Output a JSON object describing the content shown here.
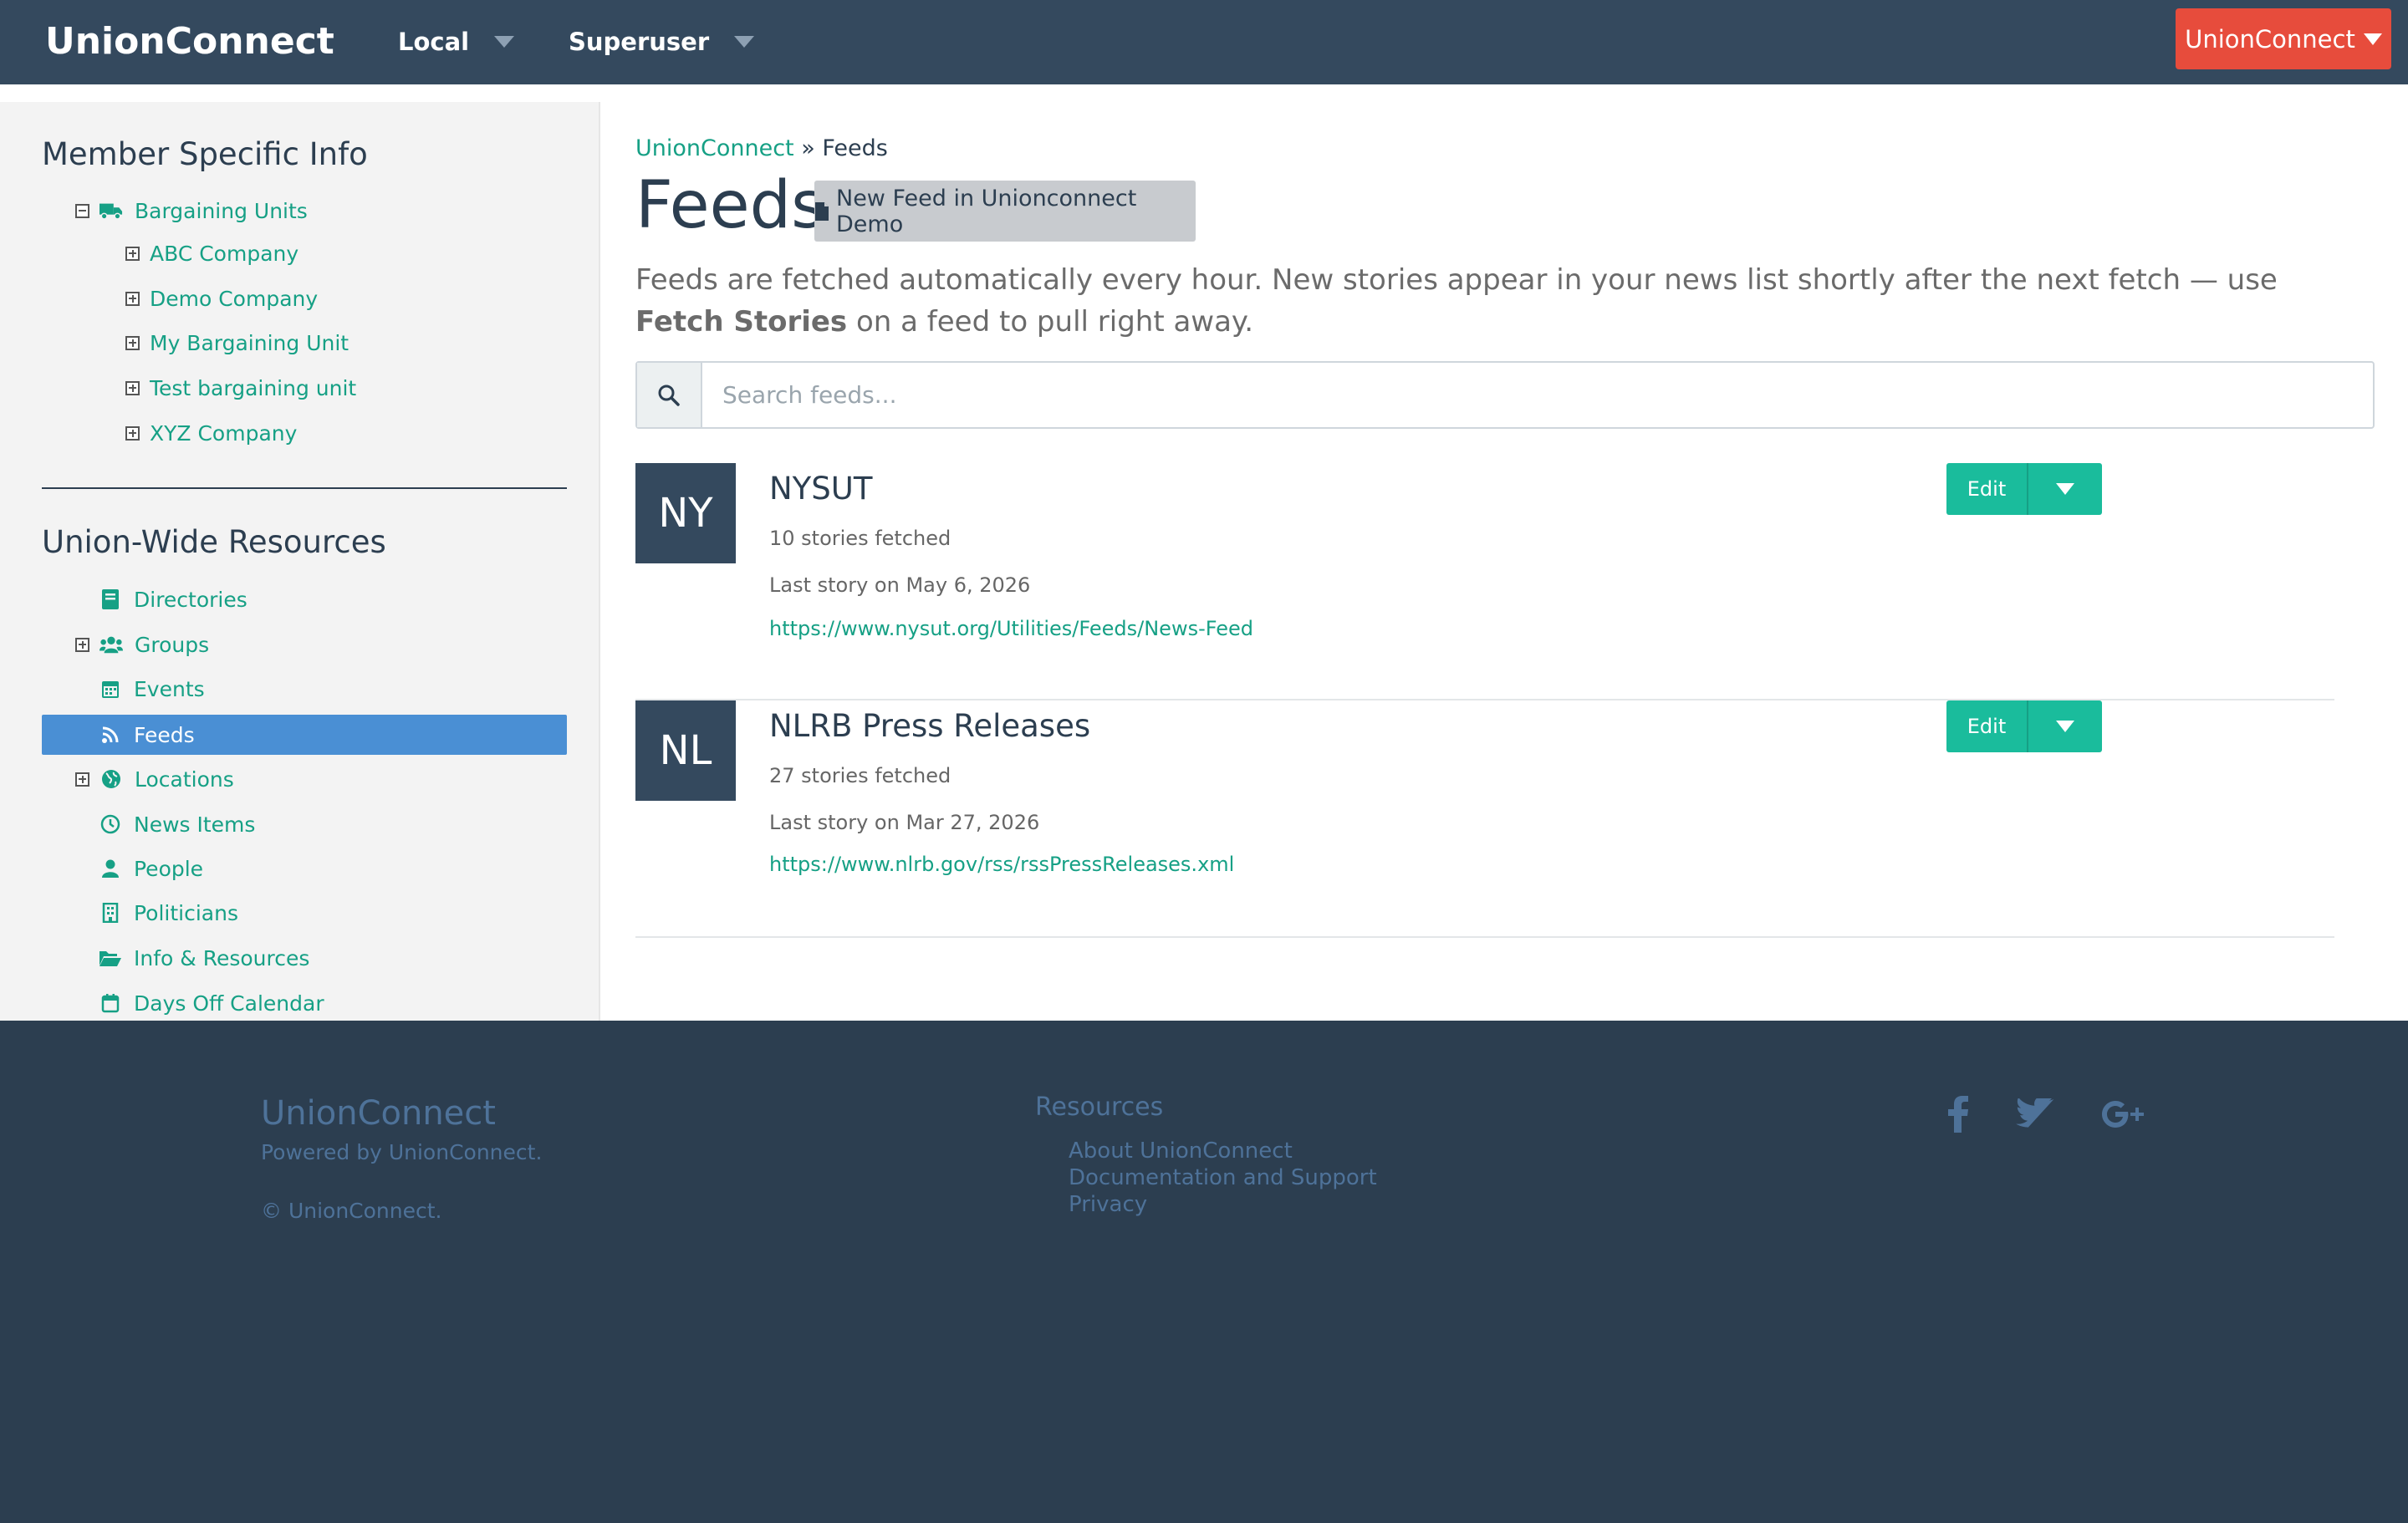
{
  "navbar": {
    "brand": "UnionConnect",
    "local_label": "Local",
    "superuser_label": "Superuser",
    "account_label": "UnionConnect"
  },
  "sidebar": {
    "member_heading": "Member Specific Info",
    "bargaining_units_label": "Bargaining Units",
    "bargaining_units": [
      "ABC Company",
      "Demo Company",
      "My Bargaining Unit",
      "Test bargaining unit",
      "XYZ Company"
    ],
    "resources_heading": "Union-Wide Resources",
    "resources": [
      {
        "label": "Directories",
        "icon": "book-icon"
      },
      {
        "label": "Groups",
        "icon": "users-icon"
      },
      {
        "label": "Events",
        "icon": "calendar-icon"
      },
      {
        "label": "Feeds",
        "icon": "rss-icon"
      },
      {
        "label": "Locations",
        "icon": "globe-icon"
      },
      {
        "label": "News Items",
        "icon": "clock-icon"
      },
      {
        "label": "People",
        "icon": "person-icon"
      },
      {
        "label": "Politicians",
        "icon": "building-icon"
      },
      {
        "label": "Info & Resources",
        "icon": "folder-open-icon"
      },
      {
        "label": "Days Off Calendar",
        "icon": "calendar-icon"
      }
    ],
    "active_item": "Feeds"
  },
  "breadcrumb": {
    "root": "UnionConnect",
    "separator": " » ",
    "current": "Feeds"
  },
  "page": {
    "title": "Feeds",
    "new_feed_button": "New Feed in Unionconnect Demo",
    "intro_text": "Feeds are fetched automatically every hour. New stories appear in your news list shortly after the next fetch — use ",
    "intro_bold": "Fetch Stories",
    "intro_tail": " on a feed to pull right away."
  },
  "search": {
    "placeholder": "Search feeds..."
  },
  "feeds": [
    {
      "initials": "NY",
      "name": "NYSUT",
      "stories": "10 stories fetched",
      "last_story": "Last story on May 6, 2026",
      "url": "https://www.nysut.org/Utilities/Feeds/News-Feed",
      "edit_label": "Edit"
    },
    {
      "initials": "NL",
      "name": "NLRB Press Releases",
      "stories": "27 stories fetched",
      "last_story": "Last story on Mar 27, 2026",
      "url": "https://www.nlrb.gov/rss/rssPressReleases.xml",
      "edit_label": "Edit"
    }
  ],
  "footer": {
    "brand": "UnionConnect",
    "powered_by": "Powered by UnionConnect.",
    "copyright": "© UnionConnect.",
    "resources_heading": "Resources",
    "links": [
      "About UnionConnect",
      "Documentation and Support",
      "Privacy"
    ],
    "social": [
      "facebook-icon",
      "twitter-icon",
      "google-plus-icon"
    ]
  },
  "colors": {
    "navbar": "#34495e",
    "accent": "#16a085",
    "button_green": "#1abc9c",
    "account_red": "#e74c3c",
    "active_blue": "#4a8fd4",
    "footer": "#2c3e50"
  }
}
